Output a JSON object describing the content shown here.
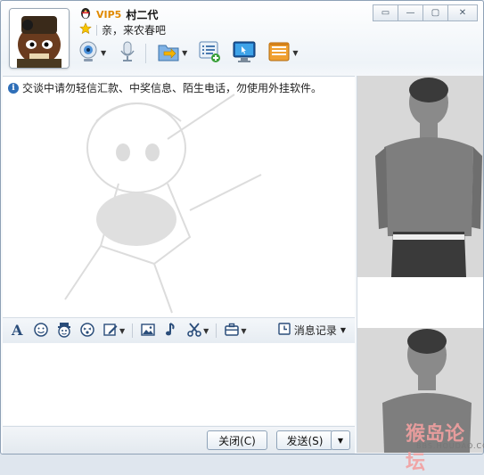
{
  "window": {
    "buttons": [
      "▭",
      "—",
      "▢",
      "✕"
    ]
  },
  "contact": {
    "vip_level": "VIP5",
    "name": "村二代",
    "signature": "亲，来农春吧"
  },
  "toolbar": {
    "items": [
      {
        "name": "video-call",
        "icon": "webcam-icon",
        "has_menu": true
      },
      {
        "name": "voice-call",
        "icon": "microphone-icon",
        "has_menu": false
      },
      {
        "name": "send-file",
        "icon": "folder-send-icon",
        "has_menu": true
      },
      {
        "name": "create-discussion",
        "icon": "discussion-add-icon",
        "has_menu": false
      },
      {
        "name": "remote-assist",
        "icon": "monitor-icon",
        "has_menu": false
      },
      {
        "name": "app-box",
        "icon": "app-box-icon",
        "has_menu": true
      }
    ]
  },
  "chat": {
    "notice": "交谈中请勿轻信汇款、中奖信息、陌生电话，勿使用外挂软件。"
  },
  "format_bar": {
    "items": [
      {
        "name": "font",
        "icon": "font-icon"
      },
      {
        "name": "emoji",
        "icon": "smiley-icon"
      },
      {
        "name": "magic-face",
        "icon": "magic-face-icon"
      },
      {
        "name": "shake",
        "icon": "shake-icon"
      },
      {
        "name": "handwriting",
        "icon": "handwriting-icon"
      },
      {
        "name": "image",
        "icon": "image-icon"
      },
      {
        "name": "music",
        "icon": "music-icon"
      },
      {
        "name": "screenshot",
        "icon": "scissors-icon"
      },
      {
        "name": "more",
        "icon": "briefcase-icon"
      }
    ],
    "history_label": "消息记录"
  },
  "buttons": {
    "close_label": "关闭(C)",
    "send_label": "发送(S)"
  },
  "watermark": {
    "text": "猴岛论坛",
    "url": "BBS.HOUDAO.COM"
  }
}
